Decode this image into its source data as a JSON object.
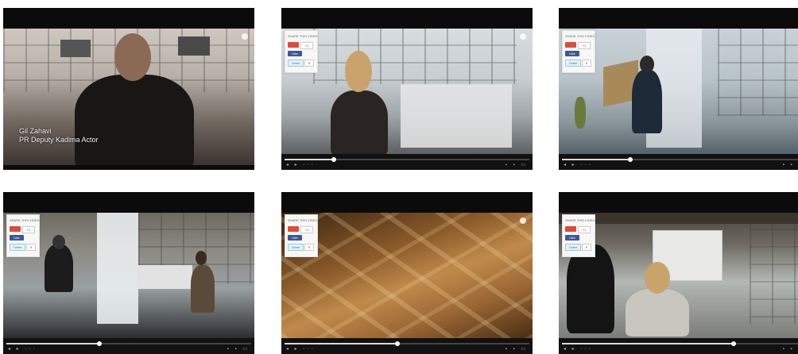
{
  "tiles": [
    {
      "id": "video-1",
      "caption_name": "Gil Zahavi",
      "caption_role": "PR Deputy Kadima Actor",
      "has_share_panel": false
    },
    {
      "id": "video-2",
      "has_share_panel": true,
      "progress_fraction": 0.2
    },
    {
      "id": "video-3",
      "has_share_panel": true,
      "progress_fraction": 0.28
    },
    {
      "id": "video-4",
      "has_share_panel": true,
      "progress_fraction": 0.38
    },
    {
      "id": "video-5",
      "has_share_panel": true,
      "progress_fraction": 0.46
    },
    {
      "id": "video-6",
      "has_share_panel": true,
      "progress_fraction": 0.7
    }
  ],
  "share_panel": {
    "title": "SHARE THIS VIDEO",
    "gplus_label": "",
    "gplus_count": "+1",
    "fb_label": "Like",
    "tw_label": "Tweet",
    "tw_count": "0"
  },
  "controls": {
    "left_glyphs": "◂ ▸ ◦◦◦",
    "right_glyphs": "▪ ▪ ▭"
  },
  "colors": {
    "facebook": "#3b5998",
    "gplus": "#dd4b39",
    "twitter": "#2b7bb9",
    "letterbox": "#0b0b0b"
  }
}
